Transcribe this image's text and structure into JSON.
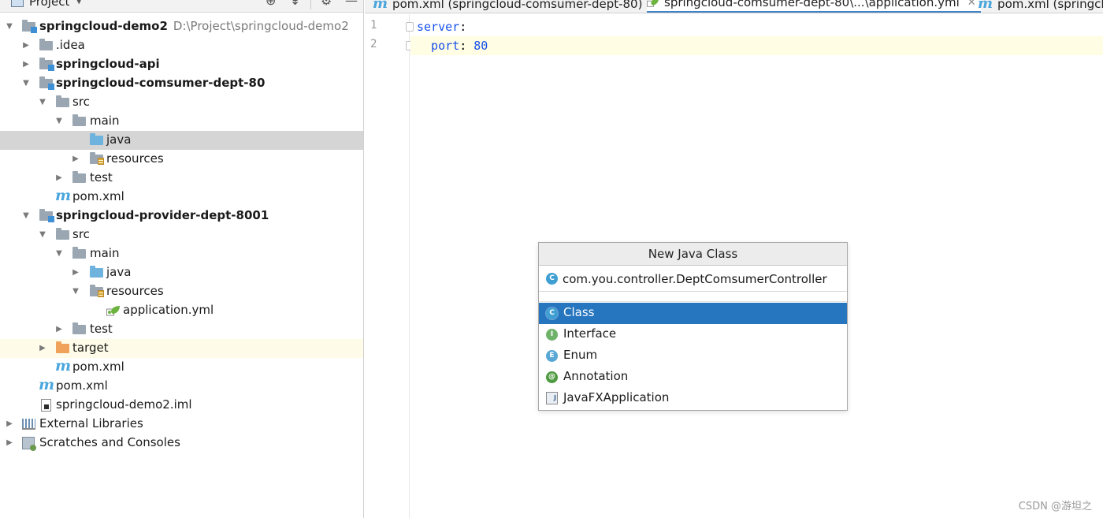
{
  "project_panel": {
    "title": "Project",
    "caret_icon": "chevron-down-icon",
    "tools": [
      "locate-icon",
      "collapse-icon",
      "gear-icon",
      "minimize-icon"
    ],
    "tree": [
      {
        "label": "springcloud-demo2",
        "path": "D:\\Project\\springcloud-demo2",
        "bold": true,
        "icon": "module-folder-icon",
        "expanded": true
      },
      {
        "label": ".idea",
        "bold": false,
        "icon": "folder-icon",
        "expanded": false
      },
      {
        "label": "springcloud-api",
        "bold": true,
        "icon": "module-folder-icon",
        "expanded": false
      },
      {
        "label": "springcloud-comsumer-dept-80",
        "bold": true,
        "icon": "module-folder-icon",
        "expanded": true
      },
      {
        "label": "src",
        "bold": false,
        "icon": "folder-icon",
        "expanded": true
      },
      {
        "label": "main",
        "bold": false,
        "icon": "folder-icon",
        "expanded": true
      },
      {
        "label": "java",
        "bold": false,
        "icon": "source-folder-icon",
        "selected": true
      },
      {
        "label": "resources",
        "bold": false,
        "icon": "resources-folder-icon",
        "expanded": false
      },
      {
        "label": "test",
        "bold": false,
        "icon": "folder-icon",
        "expanded": false
      },
      {
        "label": "pom.xml",
        "bold": false,
        "icon": "maven-icon"
      },
      {
        "label": "springcloud-provider-dept-8001",
        "bold": true,
        "icon": "module-folder-icon",
        "expanded": true
      },
      {
        "label": "src",
        "bold": false,
        "icon": "folder-icon",
        "expanded": true
      },
      {
        "label": "main",
        "bold": false,
        "icon": "folder-icon",
        "expanded": true
      },
      {
        "label": "java",
        "bold": false,
        "icon": "source-folder-icon",
        "expanded": false
      },
      {
        "label": "resources",
        "bold": false,
        "icon": "resources-folder-icon",
        "expanded": true
      },
      {
        "label": "application.yml",
        "bold": false,
        "icon": "spring-yml-icon"
      },
      {
        "label": "test",
        "bold": false,
        "icon": "folder-icon",
        "expanded": false
      },
      {
        "label": "target",
        "bold": false,
        "icon": "excluded-folder-icon",
        "expanded": false
      },
      {
        "label": "pom.xml",
        "bold": false,
        "icon": "maven-icon"
      },
      {
        "label": "pom.xml",
        "bold": false,
        "icon": "maven-icon"
      },
      {
        "label": "springcloud-demo2.iml",
        "bold": false,
        "icon": "iml-file-icon"
      },
      {
        "label": "External Libraries",
        "bold": false,
        "icon": "libraries-icon",
        "expanded": false
      },
      {
        "label": "Scratches and Consoles",
        "bold": false,
        "icon": "scratches-icon",
        "expanded": false
      }
    ]
  },
  "editor": {
    "tabs": [
      {
        "label": "pom.xml (springcloud-comsumer-dept-80)",
        "icon": "maven-icon",
        "active": false
      },
      {
        "label": "springcloud-comsumer-dept-80\\...\\application.yml",
        "icon": "spring-yml-icon",
        "active": true
      },
      {
        "label": "pom.xml (springcloud",
        "icon": "maven-icon",
        "active": false
      }
    ],
    "lines": [
      {
        "number": "1",
        "key": "server",
        "value": ""
      },
      {
        "number": "2",
        "key": "  port",
        "value": "80"
      }
    ]
  },
  "popup": {
    "title": "New Java Class",
    "input_value": "com.you.controller.DeptComsumerController",
    "kinds": [
      {
        "label": "Class",
        "letter": "C",
        "color": "#3f9fd3",
        "selected": true
      },
      {
        "label": "Interface",
        "letter": "I",
        "color": "#6fb36b",
        "selected": false
      },
      {
        "label": "Enum",
        "letter": "E",
        "color": "#58a7d4",
        "selected": false
      },
      {
        "label": "Annotation",
        "letter": "@",
        "color": "#4e9a3f",
        "selected": false
      },
      {
        "label": "JavaFXApplication",
        "letter": "J",
        "color": "#6a8fb3",
        "selected": false
      }
    ]
  },
  "watermark": "CSDN @游坦之"
}
